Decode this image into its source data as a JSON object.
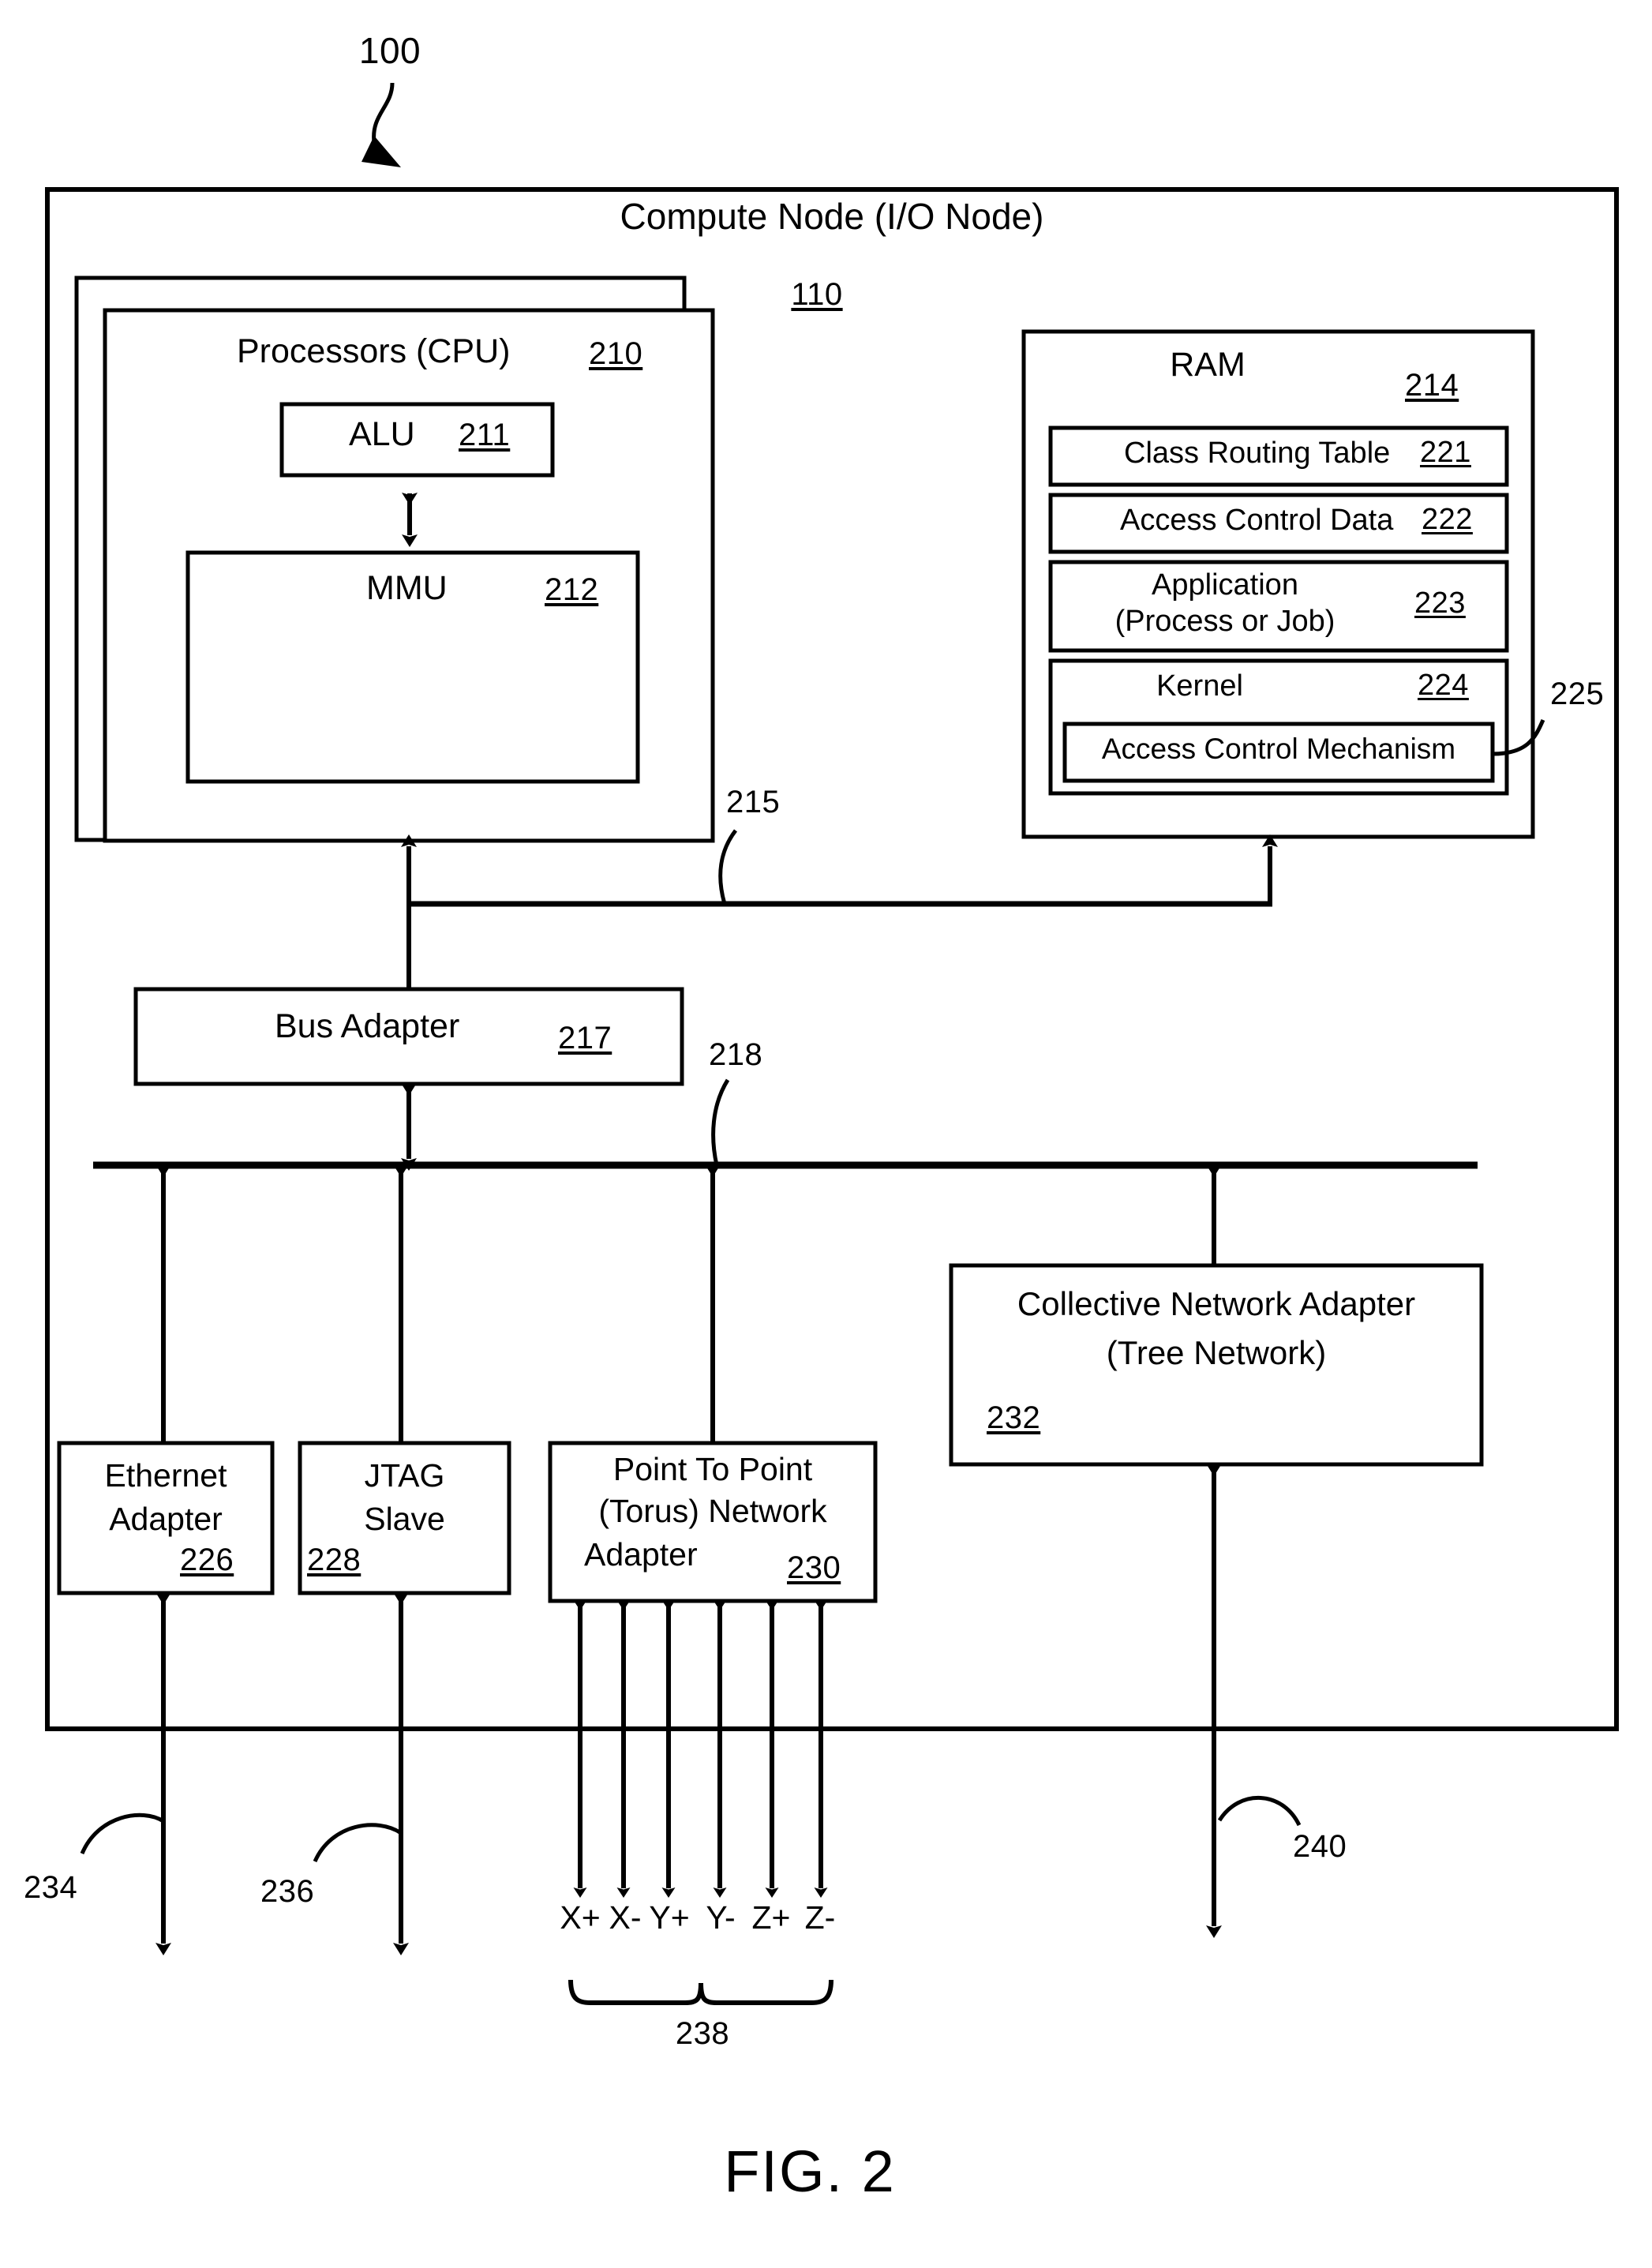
{
  "figure": {
    "caption": "FIG. 2",
    "system_ref": "100"
  },
  "outer": {
    "title": "Compute Node (I/O Node)",
    "ref": "110"
  },
  "cpu": {
    "title": "Processors (CPU)",
    "ref": "210",
    "alu": {
      "title": "ALU",
      "ref": "211"
    },
    "mmu": {
      "title": "MMU",
      "ref": "212"
    }
  },
  "ram": {
    "title": "RAM",
    "ref": "214",
    "items": [
      {
        "title": "Class Routing Table",
        "ref": "221"
      },
      {
        "title": "Access Control Data",
        "ref": "222"
      },
      {
        "title": "Application",
        "subtitle": "(Process or Job)",
        "ref": "223"
      },
      {
        "title": "Kernel",
        "ref": "224"
      }
    ],
    "access_control_mechanism": {
      "title": "Access Control Mechanism",
      "ref": "225"
    }
  },
  "bus_adapter": {
    "title": "Bus Adapter",
    "ref": "217"
  },
  "links": {
    "memory_bus_ref": "215",
    "extension_bus_ref": "218",
    "gigabit_ethernet_ref": "234",
    "jtag_master_ref": "236",
    "torus_group_ref": "238",
    "collective_link_ref": "240"
  },
  "adapters": [
    {
      "line1": "Ethernet",
      "line2": "Adapter",
      "ref": "226"
    },
    {
      "line1": "JTAG",
      "line2": "Slave",
      "ref": "228"
    },
    {
      "line1": "Point To Point",
      "line2": "(Torus) Network",
      "line3": "Adapter",
      "ref": "230"
    }
  ],
  "collective": {
    "line1": "Collective Network Adapter",
    "line2": "(Tree Network)",
    "ref": "232"
  },
  "torus_directions": [
    "X+",
    "X-",
    "Y+",
    "Y-",
    "Z+",
    "Z-"
  ]
}
